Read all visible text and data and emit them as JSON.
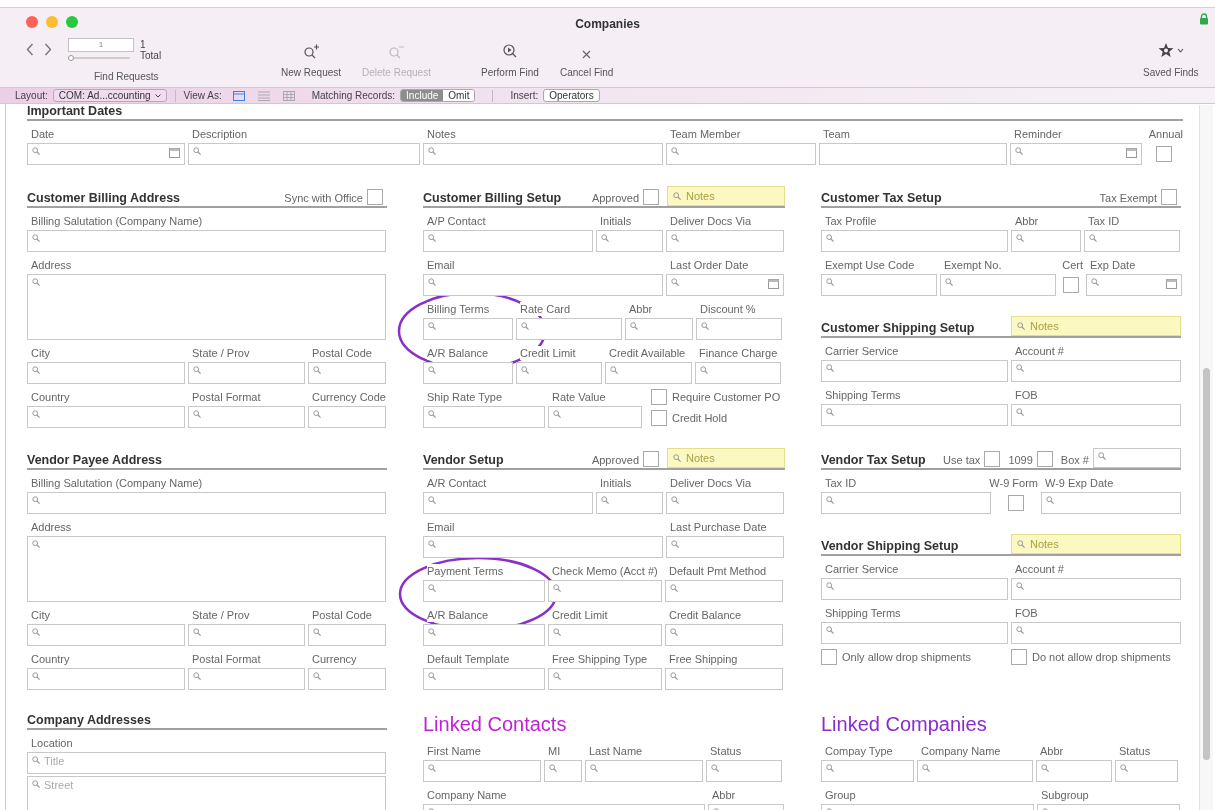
{
  "window": {
    "title": "Companies"
  },
  "toolbar": {
    "record_number": "1",
    "found_count": "1",
    "found_label": "Total",
    "level": 0,
    "nav_label": "Find Requests",
    "actions": [
      {
        "kind": "new",
        "label": "New Request",
        "disabled": false
      },
      {
        "kind": "delete",
        "label": "Delete Request",
        "disabled": true
      },
      {
        "kind": "perform",
        "label": "Perform Find",
        "disabled": false
      },
      {
        "kind": "cancel",
        "label": "Cancel Find",
        "disabled": false
      }
    ],
    "saved_finds": "Saved Finds"
  },
  "layout_bar": {
    "layout_label": "Layout:",
    "layout_value": "COM: Ad...ccounting",
    "view_as_label": "View As:",
    "views": [
      {
        "kind": "form",
        "selected": true
      },
      {
        "kind": "list",
        "selected": false
      },
      {
        "kind": "table",
        "selected": false
      }
    ],
    "matching_label": "Matching Records:",
    "matching": [
      {
        "label": "Include",
        "selected": true
      },
      {
        "label": "Omit",
        "selected": false
      }
    ],
    "insert_label": "Insert:",
    "insert_value": "Operators"
  },
  "important_dates": {
    "title": "Important Dates",
    "fields": [
      {
        "kind": "date",
        "label": "Date"
      },
      {
        "kind": "field",
        "label": "Description"
      },
      {
        "kind": "field",
        "label": "Notes"
      },
      {
        "kind": "field",
        "label": "Team Member"
      },
      {
        "kind": "plain",
        "label": "Team"
      },
      {
        "kind": "date",
        "label": "Reminder"
      },
      {
        "kind": "checkbox",
        "label": "Annual",
        "checked": false
      }
    ]
  },
  "bands": [
    {
      "columns": [
        {
          "sections": [
            {
              "kind": "plain",
              "title": "Customer Billing Address",
              "header": [
                {
                  "kind": "check",
                  "label": "Sync with Office",
                  "checked": false
                }
              ],
              "lines": [
                {
                  "fields": [
                    {
                      "kind": "field",
                      "label": "Billing Salutation (Company Name)"
                    }
                  ]
                },
                {
                  "fields": [
                    {
                      "kind": "area",
                      "label": "Address"
                    }
                  ]
                },
                {
                  "fields": [
                    {
                      "kind": "field",
                      "label": "City"
                    },
                    {
                      "kind": "field",
                      "label": "State / Prov"
                    },
                    {
                      "kind": "field",
                      "label": "Postal Code"
                    }
                  ]
                },
                {
                  "fields": [
                    {
                      "kind": "field",
                      "label": "Country"
                    },
                    {
                      "kind": "field",
                      "label": "Postal Format"
                    },
                    {
                      "kind": "field",
                      "label": "Currency Code"
                    }
                  ]
                }
              ]
            }
          ]
        },
        {
          "sections": [
            {
              "kind": "plain",
              "title": "Customer Billing Setup",
              "header": [
                {
                  "kind": "check",
                  "label": "Approved",
                  "checked": false
                },
                {
                  "kind": "notes",
                  "placeholder": "Notes"
                }
              ],
              "lines": [
                {
                  "fields": [
                    {
                      "kind": "field",
                      "label": "A/P Contact"
                    },
                    {
                      "kind": "field",
                      "label": "Initials"
                    },
                    {
                      "kind": "field",
                      "label": "Deliver Docs Via"
                    }
                  ]
                },
                {
                  "fields": [
                    {
                      "kind": "field",
                      "label": "Email"
                    },
                    {
                      "kind": "date",
                      "label": "Last Order Date"
                    }
                  ]
                },
                {
                  "fields": [
                    {
                      "kind": "field",
                      "label": "Billing Terms"
                    },
                    {
                      "kind": "field",
                      "label": "Rate Card"
                    },
                    {
                      "kind": "field",
                      "label": "Abbr"
                    },
                    {
                      "kind": "field",
                      "label": "Discount %"
                    }
                  ]
                },
                {
                  "fields": [
                    {
                      "kind": "field",
                      "label": "A/R Balance"
                    },
                    {
                      "kind": "field",
                      "label": "Credit Limit"
                    },
                    {
                      "kind": "field",
                      "label": "Credit Available"
                    },
                    {
                      "kind": "field",
                      "label": "Finance Charge"
                    }
                  ]
                },
                {
                  "fields": [
                    {
                      "kind": "field",
                      "label": "Ship Rate Type"
                    },
                    {
                      "kind": "field",
                      "label": "Rate Value"
                    },
                    {
                      "kind": "checklist",
                      "items": [
                        {
                          "label": "Require Customer PO",
                          "checked": false
                        },
                        {
                          "label": "Credit Hold",
                          "checked": false
                        }
                      ]
                    }
                  ]
                }
              ]
            }
          ]
        },
        {
          "sections": [
            {
              "kind": "plain",
              "title": "Customer Tax Setup",
              "header": [
                {
                  "kind": "check",
                  "label": "Tax Exempt",
                  "checked": false
                }
              ],
              "lines": [
                {
                  "fields": [
                    {
                      "kind": "field",
                      "label": "Tax Profile"
                    },
                    {
                      "kind": "field",
                      "label": "Abbr"
                    },
                    {
                      "kind": "field",
                      "label": "Tax ID"
                    }
                  ]
                },
                {
                  "fields": [
                    {
                      "kind": "field",
                      "label": "Exempt Use Code"
                    },
                    {
                      "kind": "field",
                      "label": "Exempt No."
                    },
                    {
                      "kind": "checkbox",
                      "label": "Cert",
                      "checked": false
                    },
                    {
                      "kind": "date",
                      "label": "Exp Date"
                    }
                  ]
                }
              ]
            },
            {
              "kind": "plain",
              "title": "Customer Shipping Setup",
              "header": [
                {
                  "kind": "notes",
                  "placeholder": "Notes"
                }
              ],
              "lines": [
                {
                  "fields": [
                    {
                      "kind": "field",
                      "label": "Carrier Service"
                    },
                    {
                      "kind": "field",
                      "label": "Account #"
                    }
                  ]
                },
                {
                  "fields": [
                    {
                      "kind": "field",
                      "label": "Shipping Terms"
                    },
                    {
                      "kind": "field",
                      "label": "FOB"
                    }
                  ]
                }
              ]
            }
          ]
        }
      ]
    },
    {
      "columns": [
        {
          "sections": [
            {
              "kind": "plain",
              "title": "Vendor Payee Address",
              "lines": [
                {
                  "fields": [
                    {
                      "kind": "field",
                      "label": "Billing Salutation (Company Name)"
                    }
                  ]
                },
                {
                  "fields": [
                    {
                      "kind": "area",
                      "label": "Address"
                    }
                  ]
                },
                {
                  "fields": [
                    {
                      "kind": "field",
                      "label": "City"
                    },
                    {
                      "kind": "field",
                      "label": "State / Prov"
                    },
                    {
                      "kind": "field",
                      "label": "Postal Code"
                    }
                  ]
                },
                {
                  "fields": [
                    {
                      "kind": "field",
                      "label": "Country"
                    },
                    {
                      "kind": "field",
                      "label": "Postal Format"
                    },
                    {
                      "kind": "field",
                      "label": "Currency"
                    }
                  ]
                }
              ]
            }
          ]
        },
        {
          "sections": [
            {
              "kind": "plain",
              "title": "Vendor Setup",
              "header": [
                {
                  "kind": "check",
                  "label": "Approved",
                  "checked": false
                },
                {
                  "kind": "notes",
                  "placeholder": "Notes"
                }
              ],
              "lines": [
                {
                  "fields": [
                    {
                      "kind": "field",
                      "label": "A/R Contact"
                    },
                    {
                      "kind": "field",
                      "label": "Initials"
                    },
                    {
                      "kind": "field",
                      "label": "Deliver Docs Via"
                    }
                  ]
                },
                {
                  "fields": [
                    {
                      "kind": "field",
                      "label": "Email"
                    },
                    {
                      "kind": "field",
                      "label": "Last Purchase Date"
                    }
                  ]
                },
                {
                  "fields": [
                    {
                      "kind": "field",
                      "label": "Payment Terms"
                    },
                    {
                      "kind": "field",
                      "label": "Check Memo (Acct #)"
                    },
                    {
                      "kind": "field",
                      "label": "Default Pmt Method"
                    }
                  ]
                },
                {
                  "fields": [
                    {
                      "kind": "field",
                      "label": "A/R Balance"
                    },
                    {
                      "kind": "field",
                      "label": "Credit Limit"
                    },
                    {
                      "kind": "field",
                      "label": "Credit Balance"
                    }
                  ]
                },
                {
                  "fields": [
                    {
                      "kind": "field",
                      "label": "Default Template"
                    },
                    {
                      "kind": "field",
                      "label": "Free Shipping Type"
                    },
                    {
                      "kind": "field",
                      "label": "Free Shipping"
                    }
                  ]
                }
              ]
            }
          ]
        },
        {
          "sections": [
            {
              "kind": "plain",
              "title": "Vendor Tax Setup",
              "header": [
                {
                  "kind": "check",
                  "label": "Use tax",
                  "checked": false
                },
                {
                  "kind": "check",
                  "label": "1099",
                  "checked": false
                },
                {
                  "kind": "field",
                  "label": "Box #"
                }
              ],
              "lines": [
                {
                  "fields": [
                    {
                      "kind": "field",
                      "label": "Tax ID"
                    },
                    {
                      "kind": "checkbox",
                      "label": "W-9 Form",
                      "checked": false
                    },
                    {
                      "kind": "field",
                      "label": "W-9 Exp Date"
                    }
                  ]
                }
              ]
            },
            {
              "kind": "plain",
              "title": "Vendor Shipping Setup",
              "header": [
                {
                  "kind": "notes",
                  "placeholder": "Notes"
                }
              ],
              "lines": [
                {
                  "fields": [
                    {
                      "kind": "field",
                      "label": "Carrier Service"
                    },
                    {
                      "kind": "field",
                      "label": "Account #"
                    }
                  ]
                },
                {
                  "fields": [
                    {
                      "kind": "field",
                      "label": "Shipping Terms"
                    },
                    {
                      "kind": "field",
                      "label": "FOB"
                    }
                  ]
                },
                {
                  "fields": [
                    {
                      "kind": "check",
                      "label": "Only allow drop shipments",
                      "checked": false
                    },
                    {
                      "kind": "check",
                      "label": "Do not allow drop shipments",
                      "checked": false
                    }
                  ]
                }
              ]
            }
          ]
        }
      ]
    },
    {
      "columns": [
        {
          "sections": [
            {
              "kind": "plain",
              "title": "Company Addresses",
              "lines": [
                {
                  "fields": [
                    {
                      "kind": "field",
                      "label": "Location",
                      "placeholder": "Title"
                    }
                  ]
                },
                {
                  "fields": [
                    {
                      "kind": "area",
                      "placeholder": "Street"
                    }
                  ]
                }
              ]
            }
          ]
        },
        {
          "sections": [
            {
              "kind": "linked",
              "title": "Linked Contacts",
              "color": "#c21fd6",
              "lines": [
                {
                  "fields": [
                    {
                      "kind": "field",
                      "label": "First Name"
                    },
                    {
                      "kind": "field",
                      "label": "MI"
                    },
                    {
                      "kind": "field",
                      "label": "Last Name"
                    },
                    {
                      "kind": "field",
                      "label": "Status"
                    }
                  ]
                },
                {
                  "fields": [
                    {
                      "kind": "field",
                      "label": "Company Name"
                    },
                    {
                      "kind": "field",
                      "label": "Abbr"
                    }
                  ]
                }
              ]
            }
          ]
        },
        {
          "sections": [
            {
              "kind": "linked",
              "title": "Linked Companies",
              "color": "#8a2bd2",
              "lines": [
                {
                  "fields": [
                    {
                      "kind": "field",
                      "label": "Compay Type"
                    },
                    {
                      "kind": "field",
                      "label": "Company Name"
                    },
                    {
                      "kind": "field",
                      "label": "Abbr"
                    },
                    {
                      "kind": "field",
                      "label": "Status"
                    }
                  ]
                },
                {
                  "fields": [
                    {
                      "kind": "field",
                      "label": "Group"
                    },
                    {
                      "kind": "field",
                      "label": "Subgroup"
                    }
                  ]
                }
              ]
            }
          ]
        }
      ]
    }
  ]
}
